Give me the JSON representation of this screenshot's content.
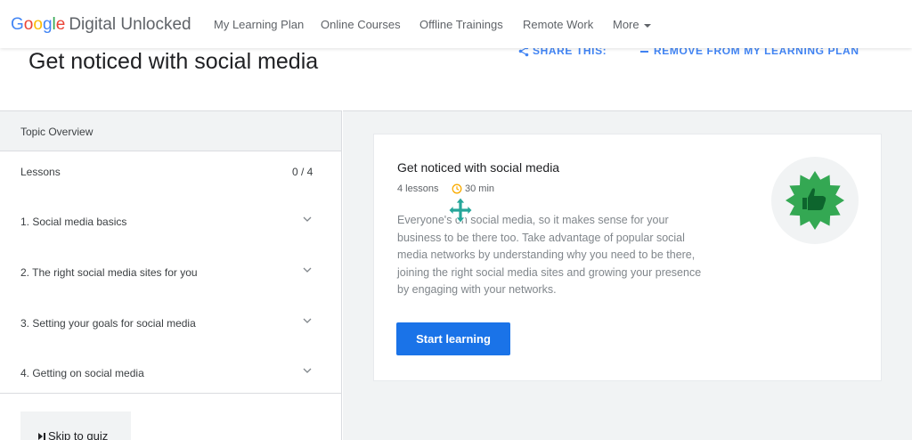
{
  "header": {
    "brand": {
      "g1": "G",
      "g2": "o",
      "g3": "o",
      "g4": "g",
      "g5": "l",
      "g6": "e",
      "rest": "Digital Unlocked"
    },
    "nav": [
      {
        "label": "My Learning Plan"
      },
      {
        "label": "Online Courses"
      },
      {
        "label": "Offline Trainings"
      },
      {
        "label": "Remote Work"
      },
      {
        "label": "More"
      }
    ]
  },
  "page": {
    "title": "Get noticed with social media",
    "share_label": "SHARE THIS:",
    "remove_label": "REMOVE FROM MY LEARNING PLAN"
  },
  "sidebar": {
    "overview_label": "Topic Overview",
    "lessons_label": "Lessons",
    "lessons_progress": "0 / 4",
    "lessons": [
      {
        "label": "1. Social media basics"
      },
      {
        "label": "2. The right social media sites for you"
      },
      {
        "label": "3. Setting your goals for social media"
      },
      {
        "label": "4. Getting on social media"
      }
    ],
    "quiz_label": "Skip to quiz"
  },
  "card": {
    "title": "Get noticed with social media",
    "lessons_count": "4 lessons",
    "duration": "30 min",
    "description": "Everyone's on social media, so it makes sense for your business to be there too. Take advantage of popular social media networks by understanding why you need to be there, joining the right social media sites and growing your presence by engaging with your networks.",
    "start_label": "Start learning",
    "badge_icon": "thumbs-up-badge-icon"
  },
  "colors": {
    "accent": "#1a73e8",
    "link": "#4285f4",
    "badge_green": "#34a853",
    "clock": "#f9ab00"
  }
}
